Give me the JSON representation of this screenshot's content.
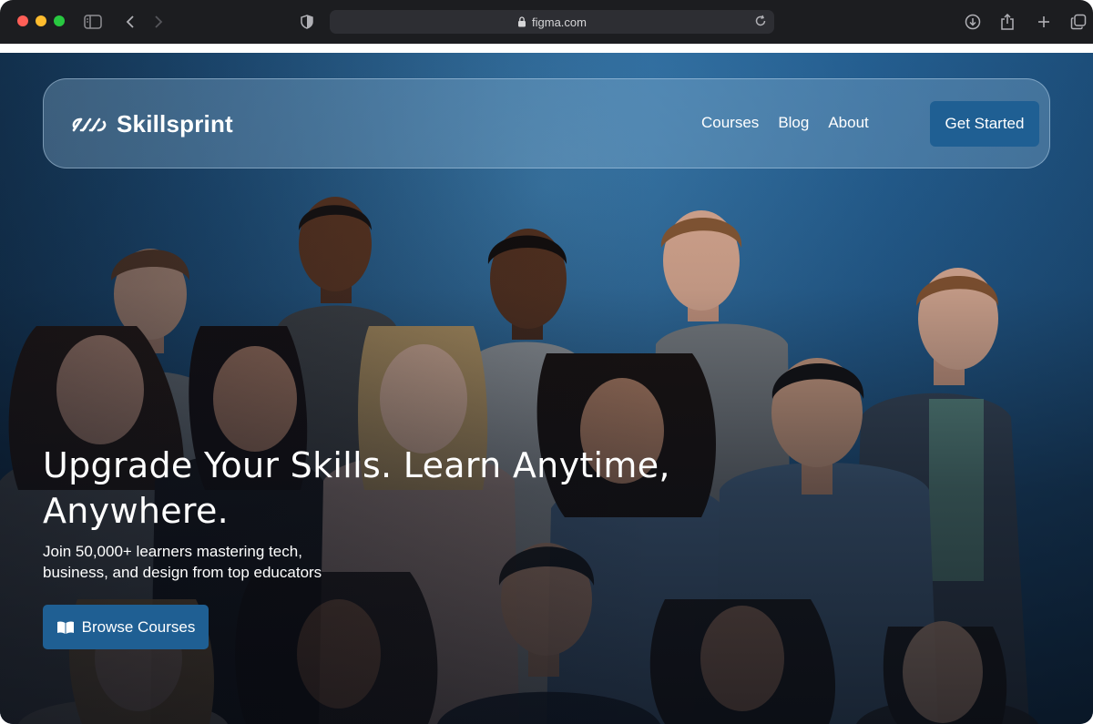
{
  "browser": {
    "url": "figma.com"
  },
  "nav": {
    "brand": "Skillsprint",
    "links": [
      "Courses",
      "Blog",
      "About"
    ],
    "cta_label": "Get Started"
  },
  "hero": {
    "title_line1": "Upgrade Your Skills. Learn Anytime,",
    "title_line2": "Anywhere.",
    "subtitle_line1": "Join 50,000+ learners mastering tech,",
    "subtitle_line2": "business, and design from top educators",
    "button_label": "Browse Courses",
    "button_icon": "book-icon"
  },
  "colors": {
    "accent": "#1f5f93",
    "background": "#245e90"
  }
}
